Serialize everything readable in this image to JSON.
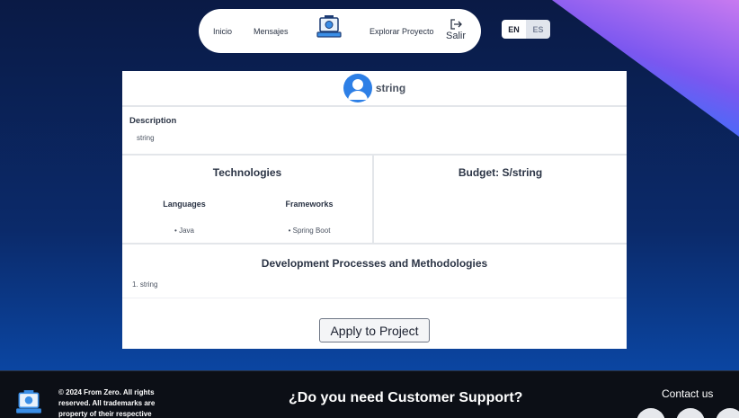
{
  "nav": {
    "inicio": "Inicio",
    "mensajes": "Mensajes",
    "explorar": "Explorar Proyecto",
    "salir": "Salir",
    "logo_icon": "laptop-logo-icon",
    "logout_icon": "logout-icon"
  },
  "language": {
    "en": "EN",
    "es": "ES",
    "selected": "EN"
  },
  "project": {
    "owner_name": "string",
    "description_title": "Description",
    "description": "string",
    "technologies_title": "Technologies",
    "languages_title": "Languages",
    "languages": [
      "Java"
    ],
    "frameworks_title": "Frameworks",
    "frameworks": [
      "Spring Boot"
    ],
    "budget_label": "Budget: S/string",
    "dev_title": "Development Processes and Methodologies",
    "methodologies": [
      "1. string"
    ],
    "apply_label": "Apply to Project"
  },
  "footer": {
    "copyright": "© 2024 From Zero. All rights reserved. All trademarks are property of their respective",
    "support": "¿Do you need Customer Support?",
    "contact": "Contact us"
  },
  "colors": {
    "accent": "#2d7fe6",
    "footer_bg": "#0c0f16",
    "page_bg": "#0b2a6a"
  }
}
